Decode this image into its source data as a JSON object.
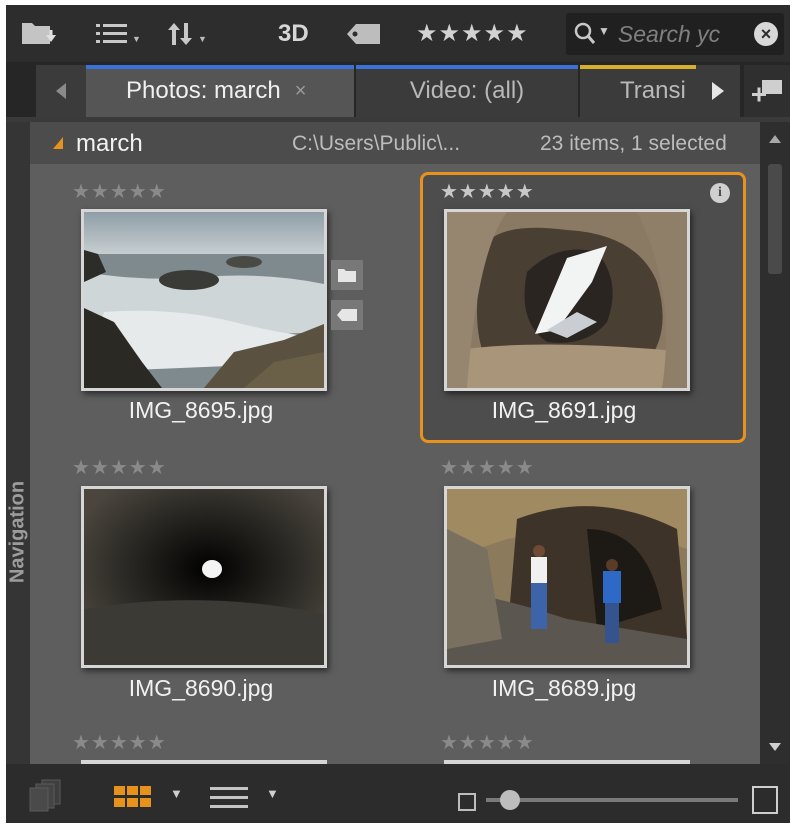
{
  "toolbar": {
    "icons": [
      "folder-import-icon",
      "list-view-menu-icon",
      "sort-icon",
      "tag-icon",
      "search-icon",
      "clear-search-icon"
    ],
    "label_3d": "3D",
    "rating_filter": "★★★★★",
    "search_placeholder": "Search yc"
  },
  "tabs": [
    {
      "label": "Photos: march",
      "active": true
    },
    {
      "label": "Video: (all)",
      "active": false
    },
    {
      "label": "Transi",
      "active": false
    }
  ],
  "folder": {
    "name": "march",
    "path": "C:\\Users\\Public\\...",
    "status": "23 items, 1 selected"
  },
  "sidebar": {
    "label": "Navigation"
  },
  "items": [
    {
      "filename": "IMG_8695.jpg",
      "rating": "★★★★★",
      "selected": false
    },
    {
      "filename": "IMG_8691.jpg",
      "rating": "★★★★★",
      "selected": true
    },
    {
      "filename": "IMG_8690.jpg",
      "rating": "★★★★★",
      "selected": false
    },
    {
      "filename": "IMG_8689.jpg",
      "rating": "★★★★★",
      "selected": false
    },
    {
      "filename": "",
      "rating": "★★★★★",
      "selected": false
    },
    {
      "filename": "",
      "rating": "★★★★★",
      "selected": false
    }
  ],
  "bottombar": {
    "icons": [
      "stack-icon",
      "grid-view-icon",
      "list-view-icon",
      "size-small-icon",
      "size-large-icon"
    ],
    "zoom_level": 0.1
  },
  "colors": {
    "accent": "#e8921e",
    "tab_photo_accent": "#3b72d8",
    "tab_video_accent": "#d6b02c"
  }
}
